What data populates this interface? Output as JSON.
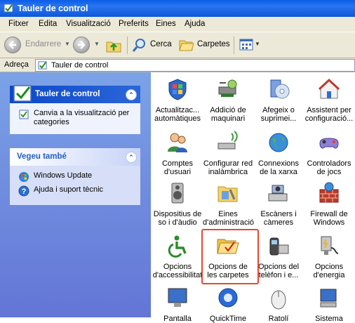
{
  "window": {
    "title": "Tauler de control"
  },
  "menu": [
    "Fitxer",
    "Edita",
    "Visualització",
    "Preferits",
    "Eines",
    "Ajuda"
  ],
  "toolbar": {
    "back_label": "Endarrere",
    "search_label": "Cerca",
    "folders_label": "Carpetes"
  },
  "address": {
    "label": "Adreça",
    "value": "Tauler de control"
  },
  "task_panel": {
    "title": "Tauler de control",
    "switch_view": "Canvia a la visualització per categories"
  },
  "see_also": {
    "title": "Vegeu també",
    "links": [
      "Windows Update",
      "Ajuda i suport tècnic"
    ]
  },
  "items": [
    {
      "label": "Actualitzac... automàtiques",
      "icon": "shield-globe-icon"
    },
    {
      "label": "Addició de maquinari",
      "icon": "hardware-add-icon"
    },
    {
      "label": "Afegeix o suprimei...",
      "icon": "add-remove-programs-icon"
    },
    {
      "label": "Assistent per configuració...",
      "icon": "home-network-icon"
    },
    {
      "label": "Comptes d'usuari",
      "icon": "user-accounts-icon"
    },
    {
      "label": "Configurar red inalàmbrica",
      "icon": "wireless-network-icon"
    },
    {
      "label": "Connexions de la xarxa",
      "icon": "network-connections-icon"
    },
    {
      "label": "Controladors de jocs",
      "icon": "game-controller-icon"
    },
    {
      "label": "Dispositius de so i d'àudio",
      "icon": "speaker-icon"
    },
    {
      "label": "Eines d'administració",
      "icon": "admin-tools-icon"
    },
    {
      "label": "Escàners i càmeres",
      "icon": "scanner-camera-icon"
    },
    {
      "label": "Firewall de Windows",
      "icon": "firewall-icon"
    },
    {
      "label": "Opcions d'accessibilitat",
      "icon": "accessibility-icon"
    },
    {
      "label": "Opcions de les carpetes",
      "icon": "folder-options-icon"
    },
    {
      "label": "Opcions del telèfon i e...",
      "icon": "phone-modem-icon"
    },
    {
      "label": "Opcions d'energia",
      "icon": "power-options-icon"
    },
    {
      "label": "Pantalla",
      "icon": "display-icon"
    },
    {
      "label": "QuickTime",
      "icon": "quicktime-icon"
    },
    {
      "label": "Ratolí",
      "icon": "mouse-icon"
    },
    {
      "label": "Sistema",
      "icon": "system-icon"
    }
  ],
  "selected_item": "Opcions de les carpetes"
}
